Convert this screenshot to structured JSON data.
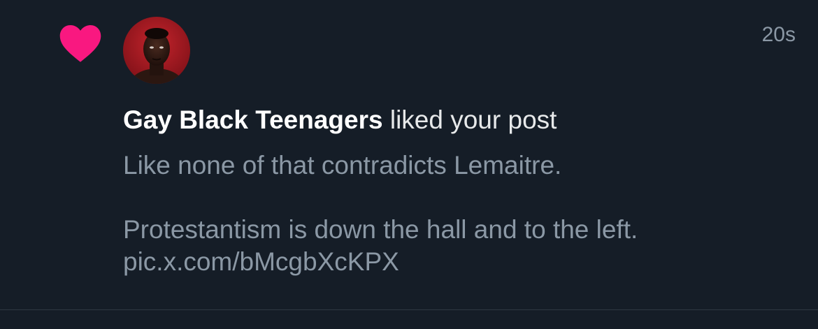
{
  "notification": {
    "icon": "heart-icon",
    "icon_color": "#f91880",
    "avatar": "avatar-photo",
    "timestamp": "20s",
    "username": "Gay Black Teenagers",
    "action": " liked your post",
    "post_lines": [
      "Like none of that contradicts Lemaitre.",
      "Protestantism is down the hall and to the left.",
      "pic.x.com/bMcgbXcKPX"
    ]
  }
}
